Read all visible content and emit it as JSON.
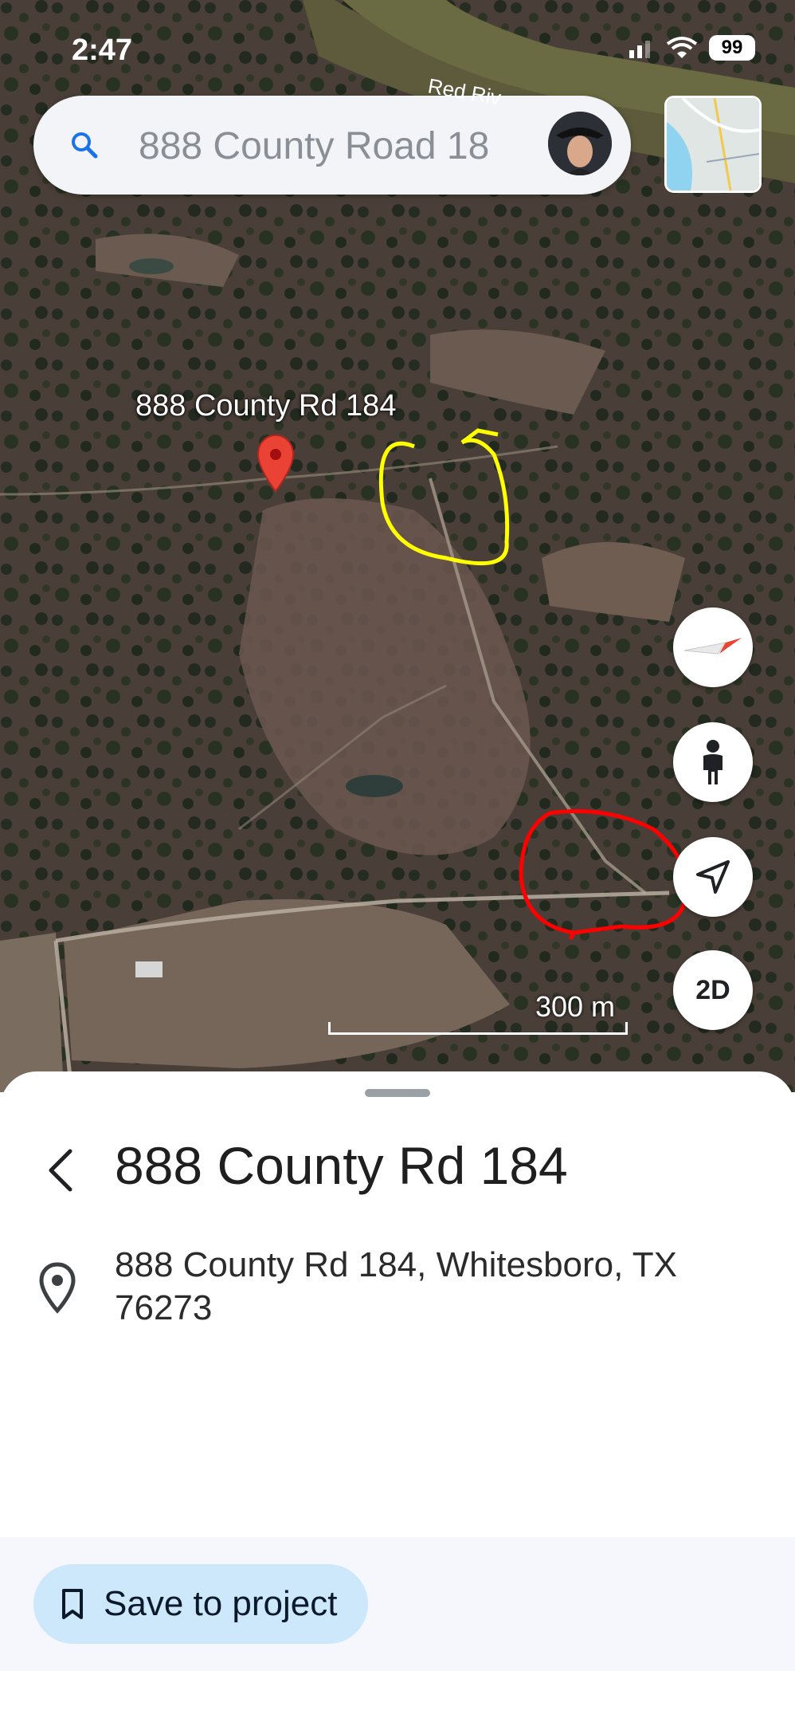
{
  "status_bar": {
    "time": "2:47",
    "battery": "99"
  },
  "search": {
    "query": "888 County Road 18"
  },
  "map": {
    "river_label": "Red Riv",
    "pin_label": "888 County Rd 184",
    "scale": "300 m",
    "view_mode": "2D",
    "pin_color": "#ea4335",
    "annotation_colors": [
      "#ffff00",
      "#ff0000"
    ]
  },
  "place": {
    "title": "888 County Rd 184",
    "address": "888 County Rd 184, Whitesboro, TX 76273"
  },
  "actions": {
    "save_label": "Save to project"
  },
  "colors": {
    "save_button_bg": "#cde7fb",
    "sheet_bg": "#ffffff",
    "search_bg": "#f2f4f7"
  }
}
